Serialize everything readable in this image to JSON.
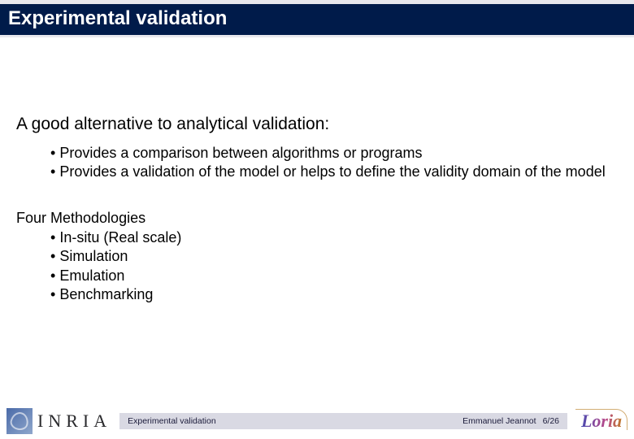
{
  "title": "Experimental validation",
  "heading": "A good alternative to analytical validation:",
  "bullets_primary": [
    "Provides a comparison between algorithms or programs",
    "Provides a validation of the model or helps to define the validity domain of the model"
  ],
  "section2_label": "Four Methodologies",
  "bullets_secondary": [
    "In-situ (Real scale)",
    "Simulation",
    "Emulation",
    "Benchmarking"
  ],
  "footer": {
    "left": "Experimental validation",
    "author": "Emmanuel Jeannot",
    "page": "6/26"
  },
  "logos": {
    "inria_text": "INRIA",
    "loria_text": "Loria"
  }
}
